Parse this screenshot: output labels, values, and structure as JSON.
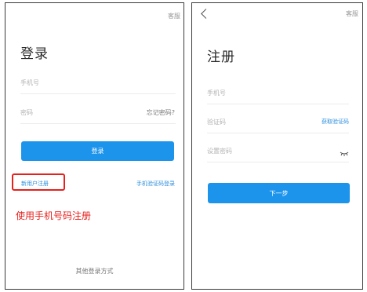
{
  "login": {
    "customer_service": "客服",
    "title": "登录",
    "phone_placeholder": "手机号",
    "password_placeholder": "密码",
    "forgot_password": "忘记密码?",
    "login_button": "登录",
    "new_user_register": "新用户注册",
    "sms_login": "手机验证码登录",
    "other_login_methods": "其他登录方式"
  },
  "annotation": {
    "text": "使用手机号码注册",
    "color": "#e5211d"
  },
  "register": {
    "customer_service": "客服",
    "title": "注册",
    "phone_placeholder": "手机号",
    "code_placeholder": "验证码",
    "get_code": "获取验证码",
    "set_password_placeholder": "设置密码",
    "next_button": "下一步"
  },
  "colors": {
    "accent_blue": "#1d94ec",
    "highlight_red": "#e5211d"
  },
  "icons": {
    "back": "chevron-left-icon",
    "password_visibility": "eye-closed-icon"
  }
}
